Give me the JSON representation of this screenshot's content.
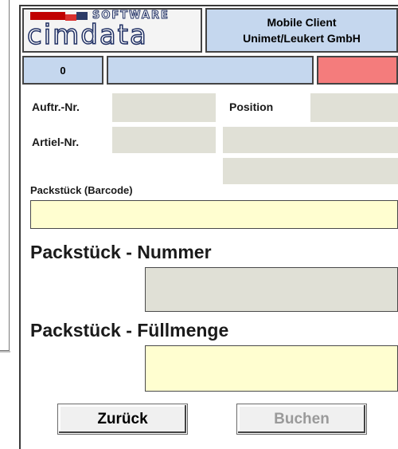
{
  "header": {
    "logo_software": "SOFTWARE",
    "logo_brand": "cimdata",
    "title_line1": "Mobile Client",
    "title_line2": "Unimet/Leukert GmbH"
  },
  "status": {
    "count": "0",
    "message": "",
    "indicator_color": "#f47c7c"
  },
  "form": {
    "order_label": "Auftr.-Nr.",
    "order_value": "",
    "position_label": "Position",
    "position_value": "",
    "article_label": "Artiel-Nr.",
    "article_value": "",
    "article_desc1": "",
    "article_desc2": "",
    "barcode_label": "Packstück (Barcode)",
    "barcode_value": "",
    "number_heading": "Packstück - Nummer",
    "number_value": "",
    "fill_heading": "Packstück - Füllmenge",
    "fill_value": ""
  },
  "buttons": {
    "back": "Zurück",
    "book": "Buchen"
  },
  "colors": {
    "header_blue": "#c5d7ee",
    "readonly_field": "#e0e0d6",
    "input_field": "#fffed0",
    "alert_red": "#f47c7c"
  }
}
